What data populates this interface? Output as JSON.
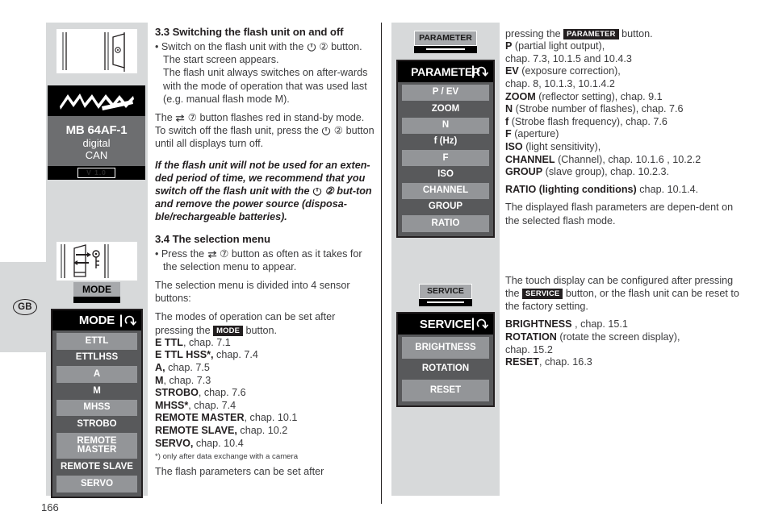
{
  "page": {
    "number": "166",
    "language_tab": "GB"
  },
  "device_screen": {
    "brand_logo": "Metz",
    "model": "MB 64AF-1",
    "line2": "digital",
    "line3": "CAN",
    "version": "V 1.0"
  },
  "buttons": {
    "mode": "MODE",
    "parameter": "PARAMETER",
    "service": "SERVICE"
  },
  "menus": {
    "mode": {
      "title": "MODE",
      "items": [
        "ETTL",
        "ETTLHSS",
        "A",
        "M",
        "MHSS",
        "STROBO",
        "REMOTE MASTER",
        "REMOTE SLAVE",
        "SERVO"
      ]
    },
    "parameter": {
      "title": "PARAMETER",
      "items": [
        "P / EV",
        "ZOOM",
        "N",
        "f (Hz)",
        "F",
        "ISO",
        "CHANNEL",
        "GROUP",
        "RATIO"
      ]
    },
    "service": {
      "title": "SERVICE",
      "items": [
        "BRIGHTNESS",
        "ROTATION",
        "RESET"
      ]
    }
  },
  "middle_column": {
    "section_33_heading": "3.3 Switching the flash unit on and off",
    "p1_a": "• Switch on the flash unit with the ",
    "p1_b": " ② button.",
    "p1_c": "The start screen appears.",
    "p1_d": "The flash unit always switches on after-wards with the mode of operation that was used last (e.g. manual flash mode M).",
    "p2_a": "The ",
    "p2_b": " ⑦ button flashes red in stand-by mode. To switch off the flash unit, press the ",
    "p2_c": " ②  button until all displays turn off.",
    "note_a": "If the flash unit will not be used for an exten-ded period of time, we recommend that you switch off the flash unit with the ",
    "note_b": " ② but-ton and remove the power source (disposa-ble/rechargeable batteries).",
    "section_34_heading": "3.4 The selection menu",
    "p3_a": "• Press the ",
    "p3_b": " ⑦ button as often as it takes for the selection menu to appear.",
    "p4": "The selection menu is divided into 4 sensor buttons:",
    "p5_a": "The modes of operation can be set after pressing the ",
    "p5_b": " button.",
    "mode_list": [
      {
        "name": "E TTL",
        "rest": ", chap. 7.1"
      },
      {
        "name": "E TTL HSS*,",
        "rest": " chap. 7.4"
      },
      {
        "name": "A,",
        "rest": " chap. 7.5"
      },
      {
        "name": "M",
        "rest": ", chap. 7.3"
      },
      {
        "name": "STROBO",
        "rest": ", chap. 7.6"
      },
      {
        "name": "MHSS*",
        "rest": ", chap. 7.4"
      },
      {
        "name": "REMOTE MASTER",
        "rest": ", chap. 10.1"
      },
      {
        "name": "REMOTE SLAVE,",
        "rest": " chap. 10.2"
      },
      {
        "name": "SERVO,",
        "rest": " chap. 10.4"
      }
    ],
    "footnote": "*) only after data exchange with a camera",
    "p6": "The flash parameters can be set after"
  },
  "right_column": {
    "p1_a": "pressing the ",
    "p1_b": " button.",
    "param_list": [
      {
        "name": "P",
        "rest": " (partial light output),"
      },
      {
        "name": "",
        "rest": "chap. 7.3, 10.1.5 and 10.4.3"
      },
      {
        "name": "EV",
        "rest": " (exposure correction),"
      },
      {
        "name": "",
        "rest": "chap. 8, 10.1.3, 10.1.4.2"
      },
      {
        "name": "ZOOM",
        "rest": " (reflector setting), chap. 9.1"
      },
      {
        "name": "N",
        "rest": " (Strobe number of flashes), chap. 7.6"
      },
      {
        "name": "f",
        "rest": " (Strobe flash frequency), chap. 7.6"
      },
      {
        "name": "F",
        "rest": " (aperture)"
      },
      {
        "name": "ISO",
        "rest": " (light sensitivity),"
      },
      {
        "name": "CHANNEL",
        "rest": " (Channel), chap. 10.1.6 , 10.2.2"
      },
      {
        "name": "GROUP",
        "rest": " (slave group), chap. 10.2.3."
      }
    ],
    "ratio_a": "RATIO (lighting conditions)",
    "ratio_b": " chap. 10.1.4.",
    "p2": "The displayed flash parameters are depen-dent on the selected flash mode.",
    "p3_a": "The touch display can be configured after pressing the ",
    "p3_b": " button, or the flash unit can be reset to the factory setting.",
    "service_list": [
      {
        "name": "BRIGHTNESS",
        "rest": " , chap. 15.1"
      },
      {
        "name": "ROTATION",
        "rest": " (rotate the screen display),"
      },
      {
        "name": "",
        "rest": "chap. 15.2"
      },
      {
        "name": "RESET",
        "rest": ", chap. 16.3"
      }
    ]
  },
  "icons": {
    "power": "power-icon",
    "swap": "swap-arrows-icon",
    "back": "back-arrow-icon"
  }
}
